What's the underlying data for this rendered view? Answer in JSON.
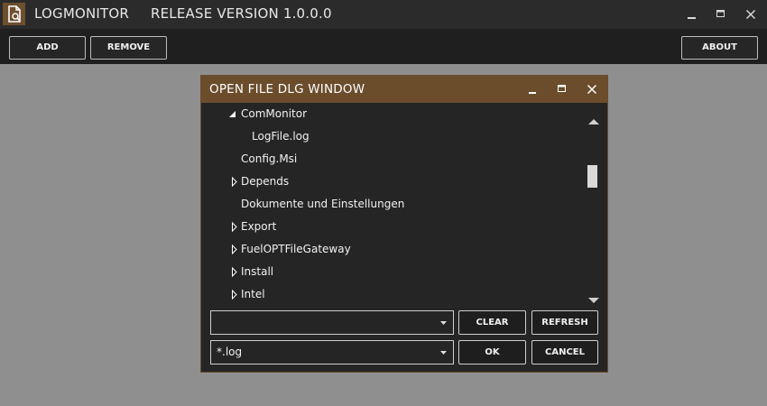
{
  "app": {
    "title": "LOGMONITOR",
    "version_label": "RELEASE VERSION 1.0.0.0"
  },
  "toolbar": {
    "add_label": "ADD",
    "remove_label": "REMOVE",
    "about_label": "ABOUT"
  },
  "dialog": {
    "title": "OPEN FILE DLG WINDOW",
    "tree": [
      {
        "label": "ComMonitor",
        "expander": "expanded",
        "level": 0
      },
      {
        "label": "LogFile.log",
        "expander": "none",
        "level": 1
      },
      {
        "label": "Config.Msi",
        "expander": "none",
        "level": 0
      },
      {
        "label": "Depends",
        "expander": "collapsed",
        "level": 0
      },
      {
        "label": "Dokumente und Einstellungen",
        "expander": "none",
        "level": 0
      },
      {
        "label": "Export",
        "expander": "collapsed",
        "level": 0
      },
      {
        "label": "FuelOPTFileGateway",
        "expander": "collapsed",
        "level": 0
      },
      {
        "label": "Install",
        "expander": "collapsed",
        "level": 0
      },
      {
        "label": "Intel",
        "expander": "collapsed",
        "level": 0
      }
    ],
    "path_combo": {
      "value": ""
    },
    "filter_combo": {
      "value": "*.log"
    },
    "clear_label": "CLEAR",
    "refresh_label": "REFRESH",
    "ok_label": "OK",
    "cancel_label": "CANCEL"
  },
  "colors": {
    "accent": "#6b4d2c",
    "titlebar": "#2b2b2b",
    "toolbar": "#1f1f1f",
    "background": "#8f8f8f",
    "dialog_body": "#252525"
  },
  "icons": {
    "app": "document-magnifier-icon",
    "minimize": "minimize-icon",
    "maximize": "maximize-icon",
    "close": "close-icon"
  }
}
